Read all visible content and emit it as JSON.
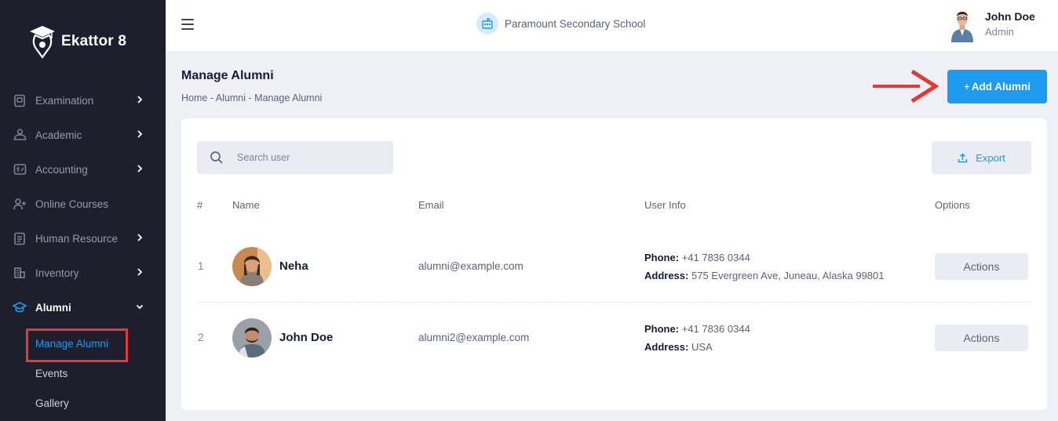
{
  "sidebar": {
    "brand": "Ekattor 8",
    "items": [
      {
        "label": "Examination",
        "icon": "exam-icon",
        "chevron": "right"
      },
      {
        "label": "Academic",
        "icon": "academic-icon",
        "chevron": "right"
      },
      {
        "label": "Accounting",
        "icon": "accounting-icon",
        "chevron": "right"
      },
      {
        "label": "Online Courses",
        "icon": "user-plus-icon",
        "chevron": ""
      },
      {
        "label": "Human Resource",
        "icon": "document-icon",
        "chevron": "right"
      },
      {
        "label": "Inventory",
        "icon": "building-icon",
        "chevron": "right"
      },
      {
        "label": "Alumni",
        "icon": "graduation-cap-icon",
        "chevron": "down"
      }
    ],
    "subitems": [
      "Manage Alumni",
      "Events",
      "Gallery"
    ]
  },
  "topbar": {
    "school": "Paramount Secondary School",
    "user_name": "John Doe",
    "user_role": "Admin"
  },
  "page": {
    "title": "Manage Alumni",
    "breadcrumb": [
      "Home",
      "Alumni",
      "Manage Alumni"
    ],
    "breadcrumb_sep": "-",
    "add_plus": "+",
    "add_label": "Add Alumni"
  },
  "table": {
    "search_placeholder": "Search user",
    "export_label": "Export",
    "headers": [
      "#",
      "Name",
      "Email",
      "User Info",
      "Options"
    ],
    "phone_label": "Phone:",
    "address_label": "Address:",
    "rows": [
      {
        "num": "1",
        "name": "Neha",
        "email": "alumni@example.com",
        "phone": "+41 7836 0344",
        "address": "575 Evergreen Ave, Juneau, Alaska 99801",
        "action": "Actions"
      },
      {
        "num": "2",
        "name": "John Doe",
        "email": "alumni2@example.com",
        "phone": "+41 7836 0344",
        "address": "USA",
        "action": "Actions"
      }
    ]
  },
  "colors": {
    "accent": "#1d9bf0",
    "sidebar": "#1e1e2d",
    "highlight": "#e53935"
  }
}
